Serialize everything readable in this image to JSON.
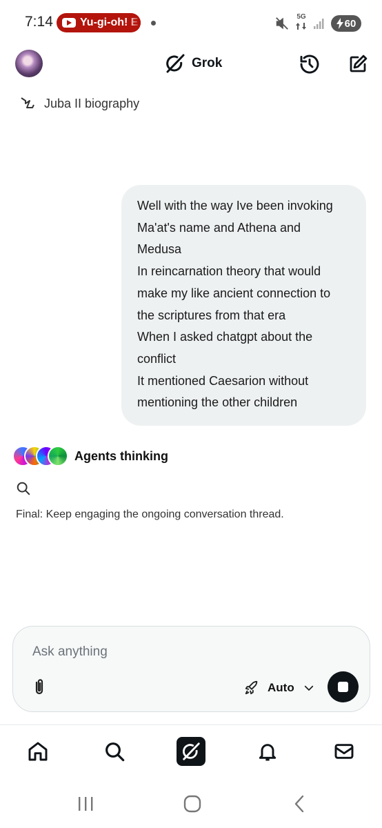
{
  "status_bar": {
    "time": "7:14",
    "notification_pill": "Yu-gi-oh! E",
    "network": "5G",
    "battery": "60",
    "colors": {
      "pill": "#b3140c",
      "battery": "#555555"
    },
    "icons": [
      "youtube-icon",
      "mute-icon",
      "data-arrows-icon",
      "signal-icon",
      "charging-bolt-icon"
    ]
  },
  "header": {
    "brand": "Grok",
    "icons": [
      "avatar",
      "grok-logo-icon",
      "history-icon",
      "new-chat-icon"
    ]
  },
  "thread": {
    "title": "Juba II biography",
    "icon": "branch-arrow-icon"
  },
  "user_message": {
    "lines": [
      "Well with the way Ive been invoking",
      "Ma'at's name and Athena and",
      "Medusa",
      "In reincarnation theory that would",
      "make my like ancient connection to",
      "the scriptures from that era",
      "When I asked chatgpt about the",
      "conflict",
      "It mentioned Caesarion without",
      "mentioning the other children"
    ],
    "bubble_color": "#eef1f2"
  },
  "agents": {
    "label": "Agents thinking",
    "final_text": "Final: Keep engaging the ongoing conversation thread."
  },
  "composer": {
    "placeholder": "Ask anything",
    "mode": "Auto",
    "icons": [
      "paperclip-icon",
      "rocket-icon",
      "chevron-down-icon",
      "stop-icon"
    ]
  },
  "bottom_nav": {
    "items": [
      "home-icon",
      "search-icon",
      "grok-icon",
      "notifications-icon",
      "messages-icon"
    ]
  },
  "system_nav": {
    "items": [
      "recents-icon",
      "home-circle-icon",
      "back-icon"
    ]
  }
}
